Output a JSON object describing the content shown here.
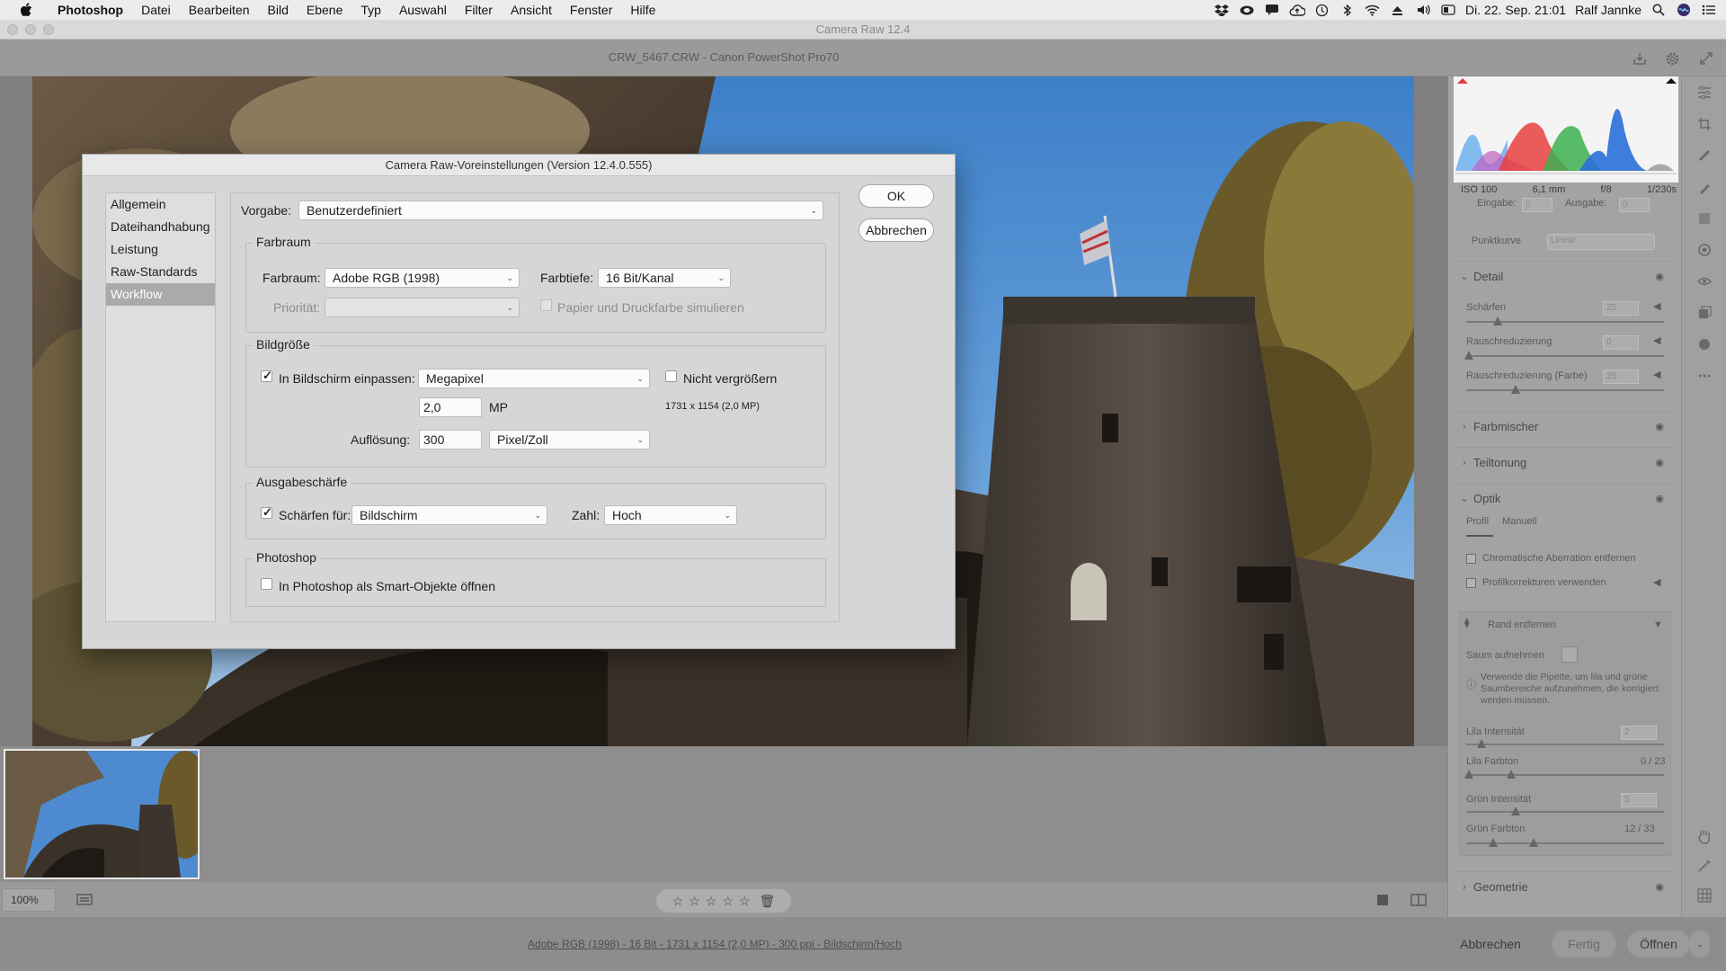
{
  "menubar": {
    "app": "Photoshop",
    "items": [
      "Datei",
      "Bearbeiten",
      "Bild",
      "Ebene",
      "Typ",
      "Auswahl",
      "Filter",
      "Ansicht",
      "Fenster",
      "Hilfe"
    ],
    "clock": "Di. 22. Sep. 21:01",
    "user": "Ralf Jannke"
  },
  "window": {
    "title": "Camera Raw 12.4",
    "filename": "CRW_5467.CRW  -  Canon PowerShot Pro70"
  },
  "right_panel": {
    "camera_info": [
      "ISO 100",
      "6,1 mm",
      "f/8",
      "1/230s"
    ],
    "curve": {
      "input_label": "Eingabe:",
      "input_value": "0",
      "output_label": "Ausgabe:",
      "output_value": "0",
      "label": "Punktkurve",
      "value": "Linear"
    },
    "sections": {
      "detail": "Detail",
      "farbmischer": "Farbmischer",
      "teiltonung": "Teiltonung",
      "optik": "Optik",
      "geometrie": "Geometrie"
    },
    "detail_sliders": [
      {
        "label": "Schärfen",
        "value": "25"
      },
      {
        "label": "Rauschreduzierung",
        "value": "0"
      },
      {
        "label": "Rauschreduzierung (Farbe)",
        "value": "25"
      }
    ],
    "optik_tabs": [
      "Profil",
      "Manuell"
    ],
    "optik_checks": [
      "Chromatische Aberration entfernen",
      "Profilkorrekturen verwenden"
    ],
    "defringe": {
      "title": "Rand entfernen",
      "sample": "Saum aufnehmen",
      "help": "Verwende die Pipette, um lila und grüne Saumbereiche aufzunehmen, die korrigiert werden müssen.",
      "sliders": [
        {
          "label": "Lila Intensität",
          "value": "2"
        },
        {
          "label": "Lila Farbton",
          "value": "0 / 23"
        },
        {
          "label": "Grün Intensität",
          "value": "5"
        },
        {
          "label": "Grün Farbton",
          "value": "12 / 33"
        }
      ]
    }
  },
  "bottom": {
    "zoom": "100%",
    "workflow_link": "Adobe RGB (1998) - 16 Bit - 1731 x 1154 (2,0 MP) - 300 ppi - Bildschirm/Hoch",
    "cancel": "Abbrechen",
    "done": "Fertig",
    "open": "Öffnen"
  },
  "dialog": {
    "title": "Camera Raw-Voreinstellungen  (Version 12.4.0.555)",
    "nav": [
      "Allgemein",
      "Dateihandhabung",
      "Leistung",
      "Raw-Standards",
      "Workflow"
    ],
    "selected_nav": "Workflow",
    "preset_label": "Vorgabe:",
    "preset_value": "Benutzerdefiniert",
    "ok": "OK",
    "cancel": "Abbrechen",
    "colorspace": {
      "group": "Farbraum",
      "label": "Farbraum:",
      "value": "Adobe RGB (1998)",
      "depth_label": "Farbtiefe:",
      "depth_value": "16 Bit/Kanal",
      "priority_label": "Priorität:",
      "priority_value": "",
      "paper_label": "Papier und Druckfarbe simulieren"
    },
    "imagesize": {
      "group": "Bildgröße",
      "fit_label": "In Bildschirm einpassen:",
      "fit_value": "Megapixel",
      "no_enlarge_label": "Nicht vergrößern",
      "mp_value": "2,0",
      "mp_unit": "MP",
      "dims": "1731 x 1154 (2,0 MP)",
      "res_label": "Auflösung:",
      "res_value": "300",
      "res_unit": "Pixel/Zoll"
    },
    "sharpen": {
      "group": "Ausgabeschärfe",
      "label": "Schärfen für:",
      "value": "Bildschirm",
      "amount_label": "Zahl:",
      "amount_value": "Hoch"
    },
    "photoshop": {
      "group": "Photoshop",
      "smart_label": "In Photoshop als Smart-Objekte öffnen"
    }
  }
}
